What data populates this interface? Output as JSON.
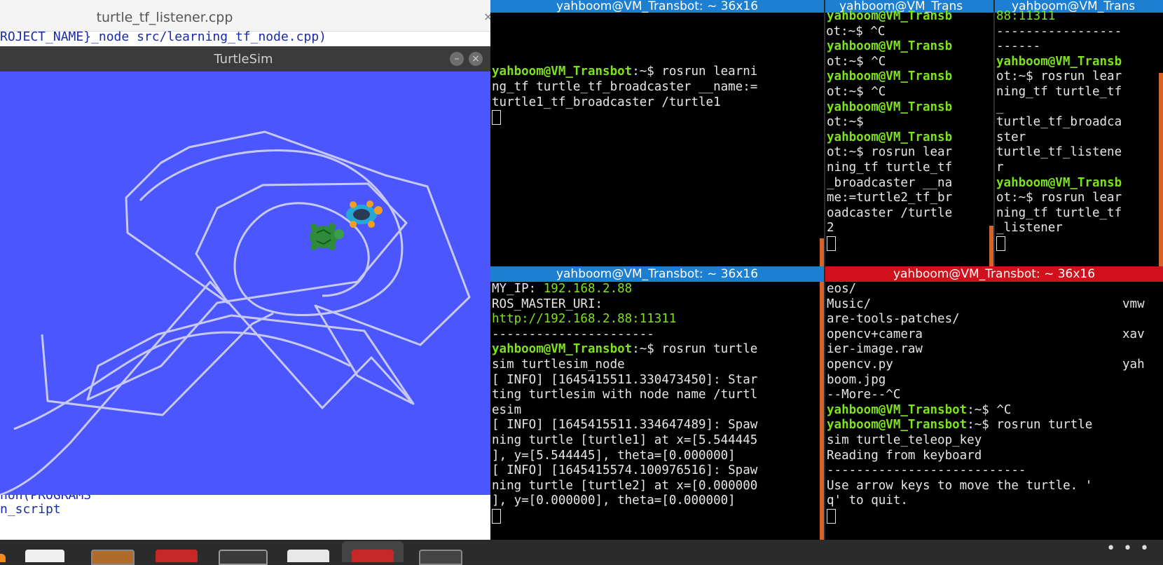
{
  "editor": {
    "tab_title": "turtle_tf_listener.cpp",
    "close_glyph": "×",
    "line_top": "ROJECT_NAME}_node src/learning_tf_node.cpp)",
    "line_bottom_1": "non(PROGRAMS",
    "line_bottom_2": "n_script"
  },
  "turtlesim": {
    "title": "TurtleSim",
    "min_glyph": "–",
    "close_glyph": "×",
    "background": "#4b56ff"
  },
  "terminals": {
    "top_left": {
      "header": "yahboom@VM_Transbot: ~ 36x16",
      "prompt": "yahboom@VM_Transbot",
      "lines": [
        "",
        "",
        "",
        "",
        ":~$ rosrun learni",
        "ng_tf turtle_tf_broadcaster __name:=",
        "turtle1_tf_broadcaster /turtle1"
      ]
    },
    "top_mid": {
      "header": "yahboom@VM_Trans",
      "lines": [
        "yahboom@VM_Transb",
        "ot:~$ ^C",
        "yahboom@VM_Transb",
        "ot:~$ ^C",
        "yahboom@VM_Transb",
        "ot:~$ ^C",
        "yahboom@VM_Transb",
        "ot:~$",
        "yahboom@VM_Transb",
        "ot:~$ rosrun lear",
        "ning_tf turtle_tf",
        "_broadcaster __na",
        "me:=turtle2_tf_br",
        "oadcaster /turtle",
        "2"
      ]
    },
    "top_right": {
      "header": "yahboom@VM_Trans",
      "lines": [
        "88:11311",
        "-----------------",
        "------",
        "yahboom@VM_Transb",
        "ot:~$ rosrun lear",
        "ning_tf turtle_tf",
        "_",
        "turtle_tf_broadca",
        "ster",
        "turtle_tf_listene",
        "r",
        "yahboom@VM_Transb",
        "ot:~$ rosrun lear",
        "ning_tf turtle_tf",
        "_listener"
      ]
    },
    "bottom_left": {
      "header": "yahboom@VM_Transbot: ~ 36x16",
      "my_ip_label": "MY_IP: ",
      "my_ip": "192.168.2.88",
      "master_label": "ROS_MASTER_URI:",
      "master_uri": "http://192.168.2.88:11311",
      "dashes": "----------------------",
      "prompt": "yahboom@VM_Transbot",
      "cmd": ":~$ rosrun turtle",
      "lines": [
        "sim turtlesim_node",
        "[ INFO] [1645415511.330473450]: Star",
        "ting turtlesim with node name /turtl",
        "esim",
        "[ INFO] [1645415511.334647489]: Spaw",
        "ning turtle [turtle1] at x=[5.544445",
        "], y=[5.544445], theta=[0.000000]",
        "[ INFO] [1645415574.100976516]: Spaw",
        "ning turtle [turtle2] at x=[0.000000",
        "], y=[0.000000], theta=[0.000000]"
      ]
    },
    "bottom_right": {
      "header": "yahboom@VM_Transbot: ~ 36x16",
      "listing": [
        [
          "eos/",
          ""
        ],
        [
          "Music/",
          "vmw"
        ],
        [
          "are-tools-patches/",
          ""
        ],
        [
          "opencv+camera",
          "xav"
        ],
        [
          "ier-image.raw",
          ""
        ],
        [
          "opencv.py",
          "yah"
        ],
        [
          "boom.jpg",
          ""
        ],
        [
          "--More--^C",
          ""
        ]
      ],
      "prompt": "yahboom@VM_Transbot",
      "cmd1": ":~$ ^C",
      "cmd2": ":~$ rosrun turtle",
      "lines": [
        "sim turtle_teleop_key",
        "Reading from keyboard",
        "---------------------------",
        "Use arrow keys to move the turtle. '",
        "q' to quit."
      ]
    }
  },
  "taskbar": {
    "more_glyph": "• • •"
  }
}
